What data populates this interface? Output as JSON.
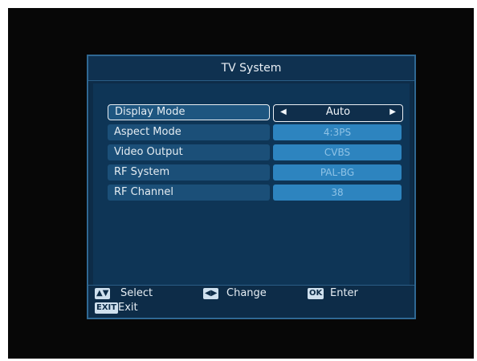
{
  "menu": {
    "title": "TV System",
    "rows": [
      {
        "label": "Display Mode",
        "value": "Auto"
      },
      {
        "label": "Aspect Mode",
        "value": "4:3PS"
      },
      {
        "label": "Video Output",
        "value": "CVBS"
      },
      {
        "label": "RF System",
        "value": "PAL-BG"
      },
      {
        "label": "RF Channel",
        "value": "38"
      }
    ]
  },
  "footer": {
    "select_key": "▲▼",
    "select_label": "Select",
    "change_key": "◀▶",
    "change_label": "Change",
    "ok_key": "OK",
    "ok_label": "Enter",
    "exit_key": "EXIT",
    "exit_label": "Exit"
  },
  "colors": {
    "background": "#070707",
    "panel": "#0e3556",
    "item": "#1b4f78",
    "value": "#2d84bf",
    "highlight_border": "#e9eef3"
  }
}
